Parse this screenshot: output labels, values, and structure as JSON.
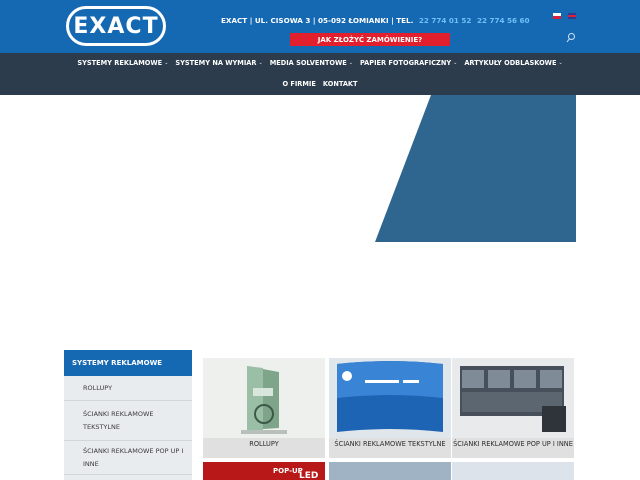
{
  "header": {
    "logo_text": "EXACT",
    "address": "EXACT | UL. CISOWA 3 | 05-092 ŁOMIANKI | TEL.",
    "phone_1": "22 774 01 52",
    "phone_2": "22 774 56 60",
    "order_button": "JAK ZŁOŻYĆ ZAMÓWIENIE?",
    "languages": [
      "pl-flag-icon",
      "en-flag-icon"
    ],
    "search_icon": "search-icon"
  },
  "nav": {
    "row1": [
      {
        "label": "SYSTEMY REKLAMOWE",
        "dropdown": true
      },
      {
        "label": "SYSTEMY NA WYMIAR",
        "dropdown": true
      },
      {
        "label": "MEDIA SOLVENTOWE",
        "dropdown": true
      },
      {
        "label": "PAPIER FOTOGRAFICZNY",
        "dropdown": true
      },
      {
        "label": "ARTYKUŁY ODBLASKOWE",
        "dropdown": true
      }
    ],
    "row2": [
      {
        "label": "O FIRMIE"
      },
      {
        "label": "KONTAKT"
      }
    ]
  },
  "sidebar": {
    "heading": "SYSTEMY REKLAMOWE",
    "items": [
      {
        "label": "ROLLUPY"
      },
      {
        "label": "ŚCIANKI REKLAMOWE TEKSTYLNE"
      },
      {
        "label": "ŚCIANKI REKLAMOWE POP UP I INNE"
      }
    ]
  },
  "products": [
    {
      "label": "ROLLUPY"
    },
    {
      "label": "ŚCIANKI REKLAMOWE TEKSTYLNE"
    },
    {
      "label": "ŚCIANKI REKLAMOWE POP UP I INNE"
    },
    {
      "label": ""
    },
    {
      "label": ""
    },
    {
      "label": ""
    }
  ],
  "colors": {
    "brand_blue": "#1569b3",
    "nav_dark": "#2c3c4c",
    "order_red": "#e2202d",
    "hero_blue": "#2f6690",
    "phone_blue": "#6ec0f5"
  }
}
